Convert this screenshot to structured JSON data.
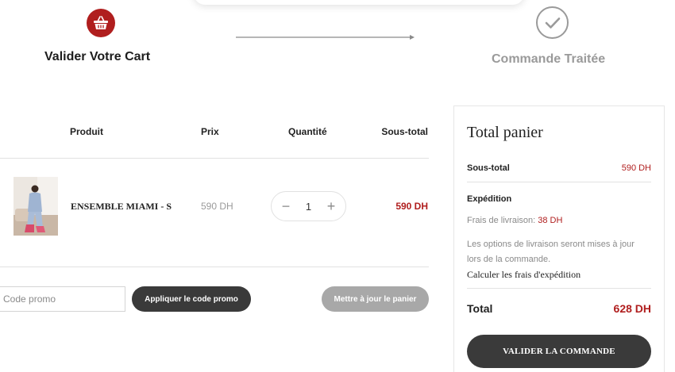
{
  "steps": [
    {
      "label": "Valider Votre Cart",
      "icon": "basket-icon",
      "state": "active",
      "color": "#b01e1e"
    },
    {
      "label": "Commande Traitée",
      "icon": "check-icon",
      "state": "done",
      "color": "#9a9a9a"
    }
  ],
  "table": {
    "headers": {
      "product": "Produit",
      "price": "Prix",
      "quantity": "Quantité",
      "subtotal": "Sous-total"
    },
    "items": [
      {
        "name": "ENSEMBLE MIAMI - S",
        "price": "590 DH",
        "quantity": "1",
        "subtotal": "590 DH"
      }
    ]
  },
  "promo": {
    "placeholder": "Code promo",
    "value": "",
    "apply_label": "Appliquer le code promo"
  },
  "update_cart_label": "Mettre à jour le panier",
  "totals": {
    "title": "Total panier",
    "subtotal_label": "Sous-total",
    "subtotal_value": "590 DH",
    "shipping_label": "Expédition",
    "shipping_fee_label": "Frais de livraison:",
    "shipping_fee_value": "38 DH",
    "shipping_note": "Les options de livraison seront mises à jour lors de la commande.",
    "calculate_label": "Calculer les frais d'expédition",
    "total_label": "Total",
    "total_value": "628 DH",
    "checkout_label": "VALIDER LA COMMANDE"
  },
  "colors": {
    "accent": "#b01e1e",
    "dark_button": "#3a3a3a",
    "muted_button": "#a8a8a8",
    "muted_text": "#9a9a9a"
  }
}
